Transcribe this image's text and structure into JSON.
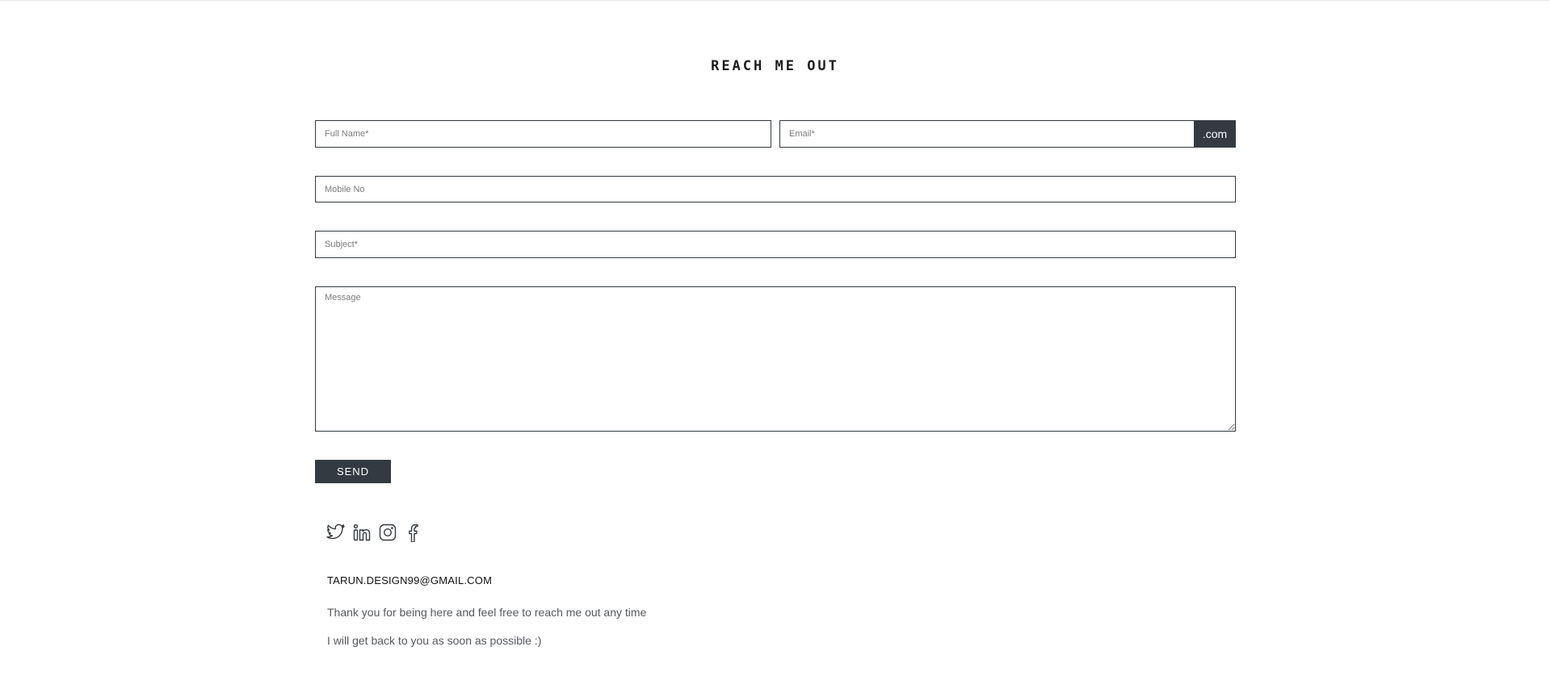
{
  "page": {
    "title": "REACH ME OUT"
  },
  "form": {
    "full_name": {
      "placeholder": "Full Name*",
      "value": ""
    },
    "email": {
      "placeholder": "Email*",
      "value": "",
      "suffix": ".com"
    },
    "mobile": {
      "placeholder": "Mobile No",
      "value": ""
    },
    "subject": {
      "placeholder": "Subject*",
      "value": ""
    },
    "message": {
      "placeholder": "Message",
      "value": ""
    },
    "send_label": "SEND"
  },
  "social": [
    {
      "name": "twitter-icon",
      "label": "Twitter"
    },
    {
      "name": "linkedin-icon",
      "label": "LinkedIn"
    },
    {
      "name": "instagram-icon",
      "label": "Instagram"
    },
    {
      "name": "facebook-icon",
      "label": "Facebook"
    }
  ],
  "contact": {
    "email": "TARUN.DESIGN99@GMAIL.COM",
    "note_1": "Thank you for being here and feel free to reach me out any time",
    "note_2": "I will get back to you as soon as possible :)"
  },
  "colors": {
    "accent_dark": "#333a42",
    "border": "#333a40",
    "text": "#555a60"
  }
}
